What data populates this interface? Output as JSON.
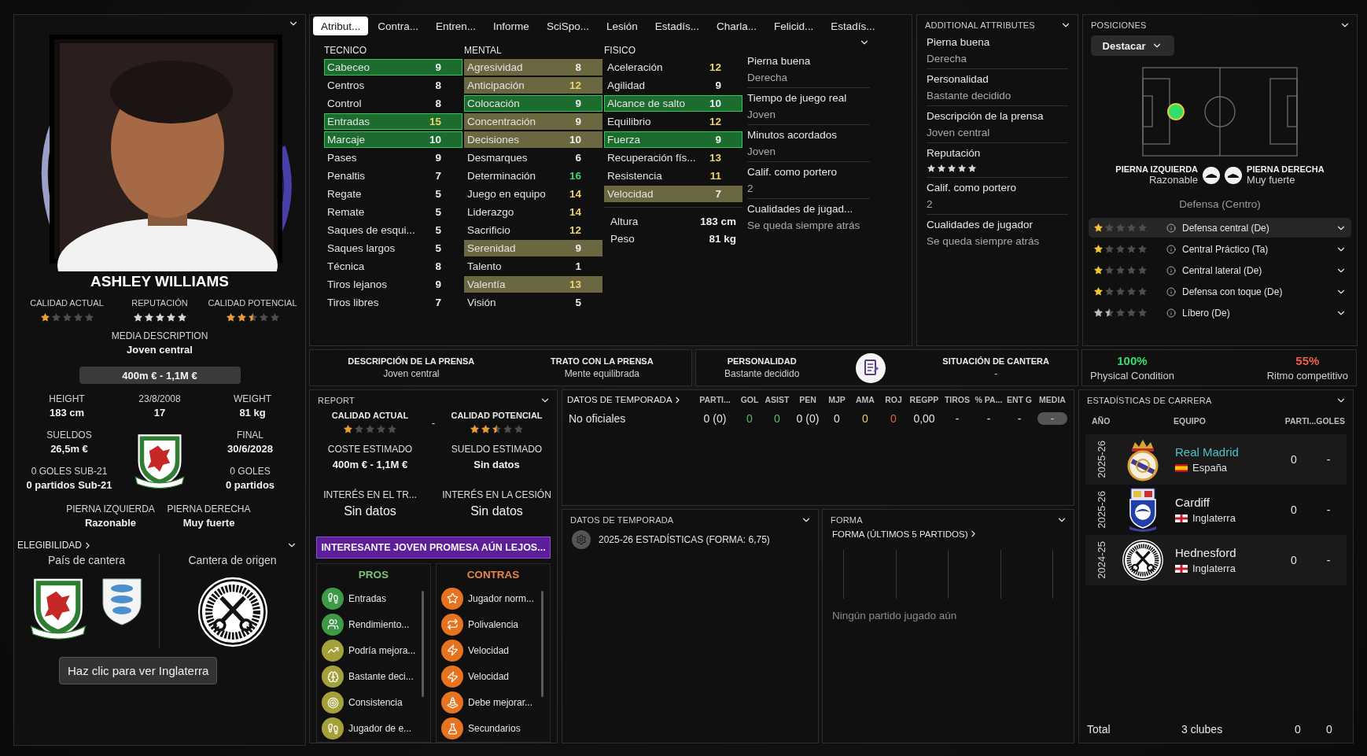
{
  "player_card": {
    "name": "ASHLEY WILLIAMS",
    "ratings": [
      {
        "label": "CALIDAD ACTUAL",
        "stars": 1,
        "color": "#e89a34"
      },
      {
        "label": "REPUTACIÓN",
        "stars": 5,
        "color": "#d6d6d6"
      },
      {
        "label": "CALIDAD POTENCIAL",
        "stars": 2.5,
        "color": "#e89a34"
      }
    ],
    "media_description": {
      "label": "MEDIA DESCRIPTION",
      "value": "Joven central"
    },
    "value_range": "400m € - 1,1M €",
    "facts": [
      {
        "label": "HEIGHT",
        "value": "183 cm"
      },
      {
        "label": "23/8/2008",
        "value": "17"
      },
      {
        "label": "WEIGHT",
        "value": "81 kg"
      }
    ],
    "contract_left": [
      {
        "label": "SUELDOS",
        "value": "26,5m €"
      },
      {
        "label": "0 GOLES SUB-21",
        "value": "0 partidos Sub-21"
      }
    ],
    "contract_right": [
      {
        "label": "FINAL",
        "value": "30/6/2028"
      },
      {
        "label": "0 GOLES",
        "value": "0 partidos"
      }
    ],
    "feet": [
      {
        "label": "PIERNA IZQUIERDA",
        "value": "Razonable"
      },
      {
        "label": "PIERNA DERECHA",
        "value": "Muy fuerte"
      }
    ],
    "eligibility": {
      "title": "ELEGIBILIDAD",
      "country_label": "País de cantera",
      "origin_label": "Cantera de origen",
      "tooltip": "Haz clic para ver Inglaterra"
    }
  },
  "tabs": [
    {
      "label": "Atribut...",
      "selected": true
    },
    {
      "label": "Contra...",
      "selected": false
    },
    {
      "label": "Entren...",
      "selected": false
    },
    {
      "label": "Informe",
      "selected": false
    },
    {
      "label": "SciSpo...",
      "selected": false
    },
    {
      "label": "Lesión",
      "selected": false
    },
    {
      "label": "Estadís...",
      "selected": false
    },
    {
      "label": "Charla...",
      "selected": false
    },
    {
      "label": "Felicid...",
      "selected": false
    },
    {
      "label": "Estadís...",
      "selected": false
    }
  ],
  "attribute_groups": [
    {
      "title": "TECNICO",
      "items": [
        {
          "name": "Cabeceo",
          "value": "9",
          "kind": "key"
        },
        {
          "name": "Centros",
          "value": "8",
          "kind": "plain"
        },
        {
          "name": "Control",
          "value": "8",
          "kind": "plain"
        },
        {
          "name": "Entradas",
          "value": "15",
          "kind": "key"
        },
        {
          "name": "Marcaje",
          "value": "10",
          "kind": "key"
        },
        {
          "name": "Pases",
          "value": "9",
          "kind": "plain"
        },
        {
          "name": "Penaltis",
          "value": "7",
          "kind": "plain"
        },
        {
          "name": "Regate",
          "value": "5",
          "kind": "plain"
        },
        {
          "name": "Remate",
          "value": "5",
          "kind": "plain"
        },
        {
          "name": "Saques de esqui...",
          "value": "5",
          "kind": "plain"
        },
        {
          "name": "Saques largos",
          "value": "5",
          "kind": "plain"
        },
        {
          "name": "Técnica",
          "value": "8",
          "kind": "plain"
        },
        {
          "name": "Tiros lejanos",
          "value": "9",
          "kind": "plain"
        },
        {
          "name": "Tiros libres",
          "value": "7",
          "kind": "plain"
        }
      ]
    },
    {
      "title": "MENTAL",
      "items": [
        {
          "name": "Agresividad",
          "value": "8",
          "kind": "secondary"
        },
        {
          "name": "Anticipación",
          "value": "12",
          "kind": "secondary"
        },
        {
          "name": "Colocación",
          "value": "9",
          "kind": "key"
        },
        {
          "name": "Concentración",
          "value": "9",
          "kind": "secondary"
        },
        {
          "name": "Decisiones",
          "value": "10",
          "kind": "secondary"
        },
        {
          "name": "Desmarques",
          "value": "6",
          "kind": "plain"
        },
        {
          "name": "Determinación",
          "value": "16",
          "kind": "plain"
        },
        {
          "name": "Juego en equipo",
          "value": "14",
          "kind": "plain"
        },
        {
          "name": "Liderazgo",
          "value": "14",
          "kind": "plain"
        },
        {
          "name": "Sacrificio",
          "value": "12",
          "kind": "plain"
        },
        {
          "name": "Serenidad",
          "value": "9",
          "kind": "secondary"
        },
        {
          "name": "Talento",
          "value": "1",
          "kind": "plain"
        },
        {
          "name": "Valentía",
          "value": "13",
          "kind": "secondary"
        },
        {
          "name": "Visión",
          "value": "5",
          "kind": "plain"
        }
      ]
    },
    {
      "title": "FISICO",
      "items": [
        {
          "name": "Aceleración",
          "value": "12",
          "kind": "plain"
        },
        {
          "name": "Agilidad",
          "value": "9",
          "kind": "plain"
        },
        {
          "name": "Alcance de salto",
          "value": "10",
          "kind": "key"
        },
        {
          "name": "Equilibrio",
          "value": "12",
          "kind": "plain"
        },
        {
          "name": "Fuerza",
          "value": "9",
          "kind": "key"
        },
        {
          "name": "Recuperación fís...",
          "value": "13",
          "kind": "plain"
        },
        {
          "name": "Resistencia",
          "value": "11",
          "kind": "plain"
        },
        {
          "name": "Velocidad",
          "value": "7",
          "kind": "secondary"
        }
      ],
      "body": [
        {
          "label": "Altura",
          "value": "183 cm"
        },
        {
          "label": "Peso",
          "value": "81 kg"
        }
      ]
    }
  ],
  "attribute_side": [
    {
      "label": "Pierna buena",
      "value": "Derecha"
    },
    {
      "label": "Tiempo de juego real",
      "value": "Joven"
    },
    {
      "label": "Minutos acordados",
      "value": "Joven"
    },
    {
      "label": "Calif. como portero",
      "value": "2"
    },
    {
      "label": "Cualidades de jugad...",
      "value": "Se queda siempre atrás"
    }
  ],
  "additional_attributes": {
    "title": "ADDITIONAL ATTRIBUTES",
    "items": [
      {
        "kind": "text",
        "label": "Pierna buena",
        "value": "Derecha"
      },
      {
        "kind": "text",
        "label": "Personalidad",
        "value": "Bastante decidido"
      },
      {
        "kind": "text",
        "label": "Descripción de la prensa",
        "value": "Joven central"
      },
      {
        "kind": "stars",
        "label": "Reputación",
        "stars": 5
      },
      {
        "kind": "text",
        "label": "Calif. como portero",
        "value": "2"
      },
      {
        "kind": "text",
        "label": "Cualidades de jugador",
        "value": "Se queda siempre atrás"
      }
    ]
  },
  "positions": {
    "title": "POSICIONES",
    "dropdown": "Destacar",
    "feet": [
      {
        "label": "PIERNA IZQUIERDA",
        "value": "Razonable"
      },
      {
        "label": "PIERNA DERECHA",
        "value": "Muy fuerte"
      }
    ],
    "position_name": "Defensa (Centro)",
    "roles": [
      {
        "name": "Defensa central (De)",
        "stars": 1,
        "color": "#f2c230",
        "selected": true
      },
      {
        "name": "Central Práctico (Ta)",
        "stars": 1,
        "color": "#f2c230",
        "selected": false
      },
      {
        "name": "Central lateral (De)",
        "stars": 1,
        "color": "#f2c230",
        "selected": false
      },
      {
        "name": "Defensa con toque (De)",
        "stars": 1,
        "color": "#f2c230",
        "selected": false
      },
      {
        "name": "Líbero (De)",
        "stars": 1.5,
        "color": "#bdbdbd",
        "selected": false
      }
    ]
  },
  "press": [
    {
      "label": "DESCRIPCIÓN DE LA PRENSA",
      "value": "Joven central"
    },
    {
      "label": "TRATO CON LA PRENSA",
      "value": "Mente equilibrada"
    }
  ],
  "personality": [
    {
      "label": "PERSONALIDAD",
      "value": "Bastante decidido"
    },
    {
      "label": "SITUACIÓN DE CANTERA",
      "value": "-"
    }
  ],
  "condition": [
    {
      "value": "100%",
      "label": "Physical Condition",
      "color": "#3ddc6a"
    },
    {
      "value": "55%",
      "label": "Ritmo competitivo",
      "color": "#e8604a"
    }
  ],
  "report": {
    "title": "REPORT",
    "ratings": [
      {
        "label": "CALIDAD ACTUAL",
        "stars": 1,
        "color": "#e89a34"
      },
      {
        "label": "CALIDAD POTENCIAL",
        "stars": 2.5,
        "color": "#e89a34"
      }
    ],
    "separator": "-",
    "fields": [
      {
        "label": "COSTE ESTIMADO",
        "value": "400m € - 1,1M €"
      },
      {
        "label": "SUELDO ESTIMADO",
        "value": "Sin datos"
      },
      {
        "label": "INTERÉS EN EL TR...",
        "value": "Sin datos"
      },
      {
        "label": "INTERÉS EN LA CESIÓN",
        "value": "Sin datos"
      }
    ],
    "banner": "INTERESANTE JOVEN PROMESA AÚN LEJOS...",
    "lists": [
      {
        "title": "PROS",
        "color": "#7ec27a",
        "items": [
          {
            "label": "Entradas",
            "kind": "footprints",
            "color": "#3f9a48"
          },
          {
            "label": "Rendimiento...",
            "kind": "users",
            "color": "#3f9a48"
          },
          {
            "label": "Podría mejora...",
            "kind": "trend",
            "color": "#a5a13a"
          },
          {
            "label": "Bastante deci...",
            "kind": "brain",
            "color": "#a5a13a"
          },
          {
            "label": "Consistencia",
            "kind": "target",
            "color": "#a5a13a"
          },
          {
            "label": "Jugador de e...",
            "kind": "footprints",
            "color": "#a5a13a"
          }
        ]
      },
      {
        "title": "CONTRAS",
        "color": "#e8844a",
        "items": [
          {
            "label": "Jugador norm...",
            "kind": "star",
            "color": "#e8731f"
          },
          {
            "label": "Polivalencia",
            "kind": "repeat",
            "color": "#e8731f"
          },
          {
            "label": "Velocidad",
            "kind": "zap",
            "color": "#e8731f"
          },
          {
            "label": "Velocidad",
            "kind": "zap",
            "color": "#e8731f"
          },
          {
            "label": "Debe mejorar...",
            "kind": "cone",
            "color": "#e8731f"
          },
          {
            "label": "Secundarios",
            "kind": "flask",
            "color": "#e8731f"
          }
        ]
      }
    ]
  },
  "season_table": {
    "title": "DATOS DE TEMPORADA",
    "columns": [
      {
        "label": "PARTI..."
      },
      {
        "label": "GOL",
        "color": "#4cc06a"
      },
      {
        "label": "ASIST",
        "color": "#4cc06a"
      },
      {
        "label": "PEN"
      },
      {
        "label": "MJP"
      },
      {
        "label": "AMA",
        "color": "#e8d050"
      },
      {
        "label": "ROJ",
        "color": "#e0604a"
      },
      {
        "label": "REGPP"
      },
      {
        "label": "TIROS"
      },
      {
        "label": "% PA..."
      },
      {
        "label": "ENT G"
      },
      {
        "label": "MEDIA"
      }
    ],
    "rows": [
      {
        "label": "No oficiales",
        "cells": [
          "0 (0)",
          "0",
          "0",
          "0 (0)",
          "0",
          "0",
          "0",
          "0,00",
          "-",
          "-",
          "-",
          "-"
        ]
      }
    ]
  },
  "season_data": {
    "title": "DATOS DE TEMPORADA",
    "item": "2025-26 ESTADÍSTICAS (FORMA: 6,75)"
  },
  "form": {
    "title": "FORMA",
    "subtitle": "FORMA (ÚLTIMOS 5 PARTIDOS)",
    "empty": "Ningún partido jugado aún"
  },
  "career": {
    "title": "ESTADÍSTICAS DE CARRERA",
    "columns": [
      "AÑO",
      "EQUIPO",
      "PARTI...GOLES"
    ],
    "rows": [
      {
        "season": "2025-26",
        "team": "Real Madrid",
        "country": {
          "name": "España",
          "kind": "spain"
        },
        "crest": {
          "kind": "crown"
        },
        "current": true,
        "apps": "0",
        "goals": "-"
      },
      {
        "season": "2025-26",
        "team": "Cardiff",
        "country": {
          "name": "Inglaterra",
          "kind": "england"
        },
        "crest": {
          "kind": "bird"
        },
        "current": false,
        "apps": "0",
        "goals": "-"
      },
      {
        "season": "2024-25",
        "team": "Hednesford",
        "country": {
          "name": "Inglaterra",
          "kind": "england"
        },
        "crest": {
          "kind": "keys"
        },
        "current": false,
        "apps": "0",
        "goals": "-"
      }
    ],
    "total": {
      "label": "Total",
      "clubs": "3 clubes",
      "apps": "0",
      "goals": "0"
    }
  }
}
